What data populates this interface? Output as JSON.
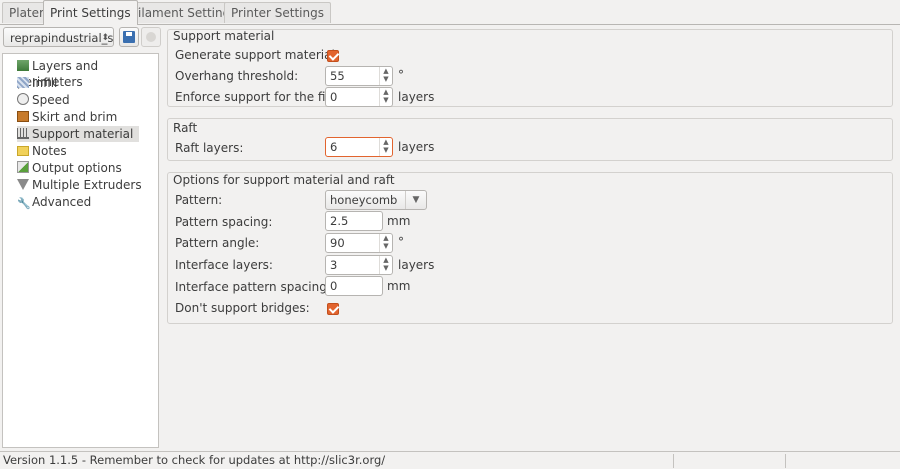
{
  "tabs": [
    "Plater",
    "Print Settings",
    "Filament Settings",
    "Printer Settings"
  ],
  "active_tab": "Print Settings",
  "preset": {
    "value": "reprapindustrial_s"
  },
  "tree": [
    {
      "label": "Layers and perimeters",
      "icon": "layers-icon"
    },
    {
      "label": "Infill",
      "icon": "infill-icon"
    },
    {
      "label": "Speed",
      "icon": "speed-icon"
    },
    {
      "label": "Skirt and brim",
      "icon": "skirt-icon"
    },
    {
      "label": "Support material",
      "icon": "support-icon",
      "selected": true
    },
    {
      "label": "Notes",
      "icon": "notes-icon"
    },
    {
      "label": "Output options",
      "icon": "output-icon"
    },
    {
      "label": "Multiple Extruders",
      "icon": "extruders-icon"
    },
    {
      "label": "Advanced",
      "icon": "advanced-icon"
    }
  ],
  "support": {
    "title": "Support material",
    "generate_label": "Generate support material:",
    "generate_checked": true,
    "overhang_label": "Overhang threshold:",
    "overhang_value": "55",
    "overhang_unit": "°",
    "enforce_label": "Enforce support for the first:",
    "enforce_value": "0",
    "enforce_unit": "layers"
  },
  "raft": {
    "title": "Raft",
    "layers_label": "Raft layers:",
    "layers_value": "6",
    "layers_unit": "layers"
  },
  "options": {
    "title": "Options for support material and raft",
    "pattern_label": "Pattern:",
    "pattern_value": "honeycomb",
    "spacing_label": "Pattern spacing:",
    "spacing_value": "2.5",
    "spacing_unit": "mm",
    "angle_label": "Pattern angle:",
    "angle_value": "90",
    "angle_unit": "°",
    "interface_label": "Interface layers:",
    "interface_value": "3",
    "interface_unit": "layers",
    "interface_spacing_label": "Interface pattern spacing:",
    "interface_spacing_value": "0",
    "interface_spacing_unit": "mm",
    "bridges_label": "Don't support bridges:",
    "bridges_checked": true
  },
  "status": {
    "text": "Version 1.1.5 - Remember to check for updates at http://slic3r.org/"
  },
  "colors": {
    "accent": "#e2642e",
    "window_bg": "#f2f1f0"
  }
}
